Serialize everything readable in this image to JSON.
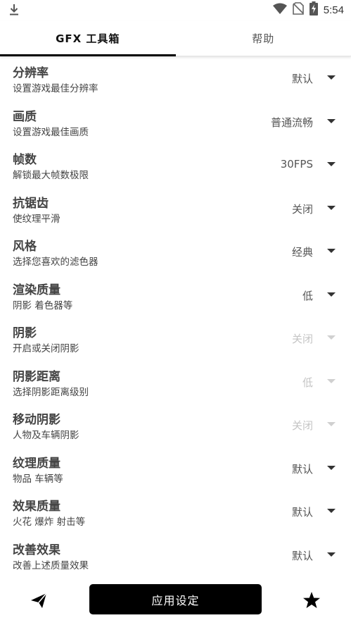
{
  "status_bar": {
    "time": "5:54",
    "icons": [
      "download-icon",
      "wifi-icon",
      "no-sim-icon",
      "battery-charging-icon"
    ]
  },
  "tabs": [
    {
      "label": "GFX 工具箱",
      "active": true
    },
    {
      "label": "帮助",
      "active": false
    }
  ],
  "settings": [
    {
      "title": "分辨率",
      "subtitle": "设置游戏最佳分辨率",
      "value": "默认",
      "enabled": true
    },
    {
      "title": "画质",
      "subtitle": "设置游戏最佳画质",
      "value": "普通流畅",
      "enabled": true
    },
    {
      "title": "帧数",
      "subtitle": "解锁最大帧数极限",
      "value": "30FPS",
      "enabled": true
    },
    {
      "title": "抗锯齿",
      "subtitle": "使纹理平滑",
      "value": "关闭",
      "enabled": true
    },
    {
      "title": "风格",
      "subtitle": "选择您喜欢的滤色器",
      "value": "经典",
      "enabled": true
    },
    {
      "title": "渲染质量",
      "subtitle": "阴影 着色器等",
      "value": "低",
      "enabled": true
    },
    {
      "title": "阴影",
      "subtitle": "开启或关闭阴影",
      "value": "关闭",
      "enabled": false
    },
    {
      "title": "阴影距离",
      "subtitle": "选择阴影距离级别",
      "value": "低",
      "enabled": false
    },
    {
      "title": "移动阴影",
      "subtitle": "人物及车辆阴影",
      "value": "关闭",
      "enabled": false
    },
    {
      "title": "纹理质量",
      "subtitle": "物品 车辆等",
      "value": "默认",
      "enabled": true
    },
    {
      "title": "效果质量",
      "subtitle": "火花 爆炸 射击等",
      "value": "默认",
      "enabled": true
    },
    {
      "title": "改善效果",
      "subtitle": "改善上述质量效果",
      "value": "默认",
      "enabled": true
    }
  ],
  "bottom_bar": {
    "apply_label": "应用设定",
    "left_icon": "send-icon",
    "right_icon": "star-icon"
  },
  "colors": {
    "accent": "#000000",
    "text_primary": "#444444",
    "disabled": "#c4c4c4"
  }
}
